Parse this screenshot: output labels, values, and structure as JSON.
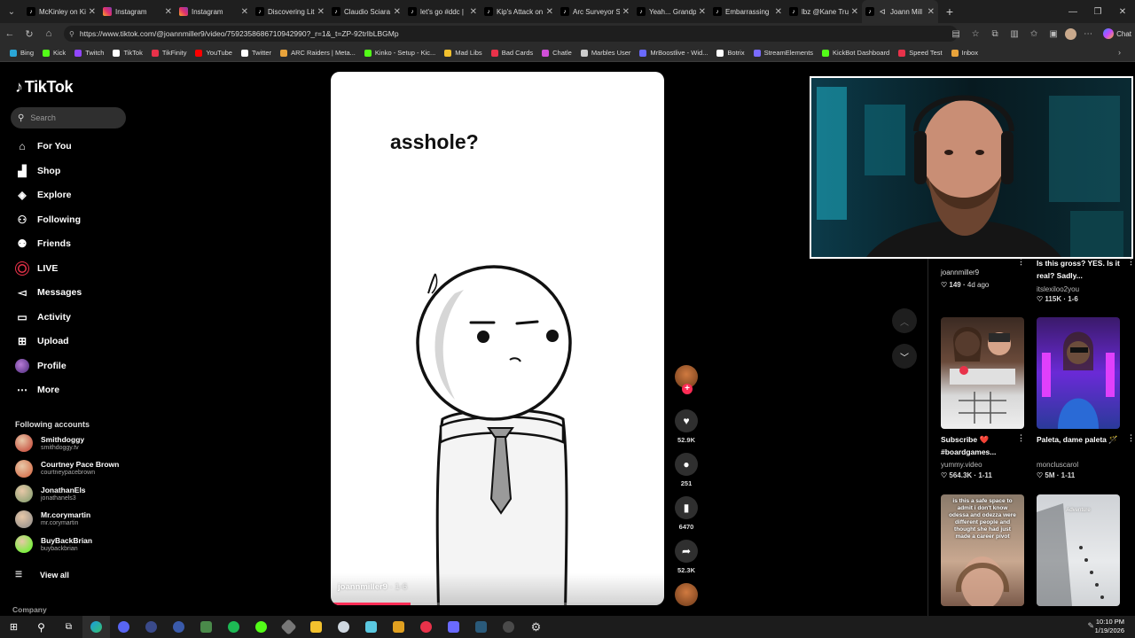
{
  "browser": {
    "tabs": [
      {
        "title": "McKinley on Ki",
        "favicon": "tiktok-icon"
      },
      {
        "title": "Instagram",
        "favicon": "instagram-icon"
      },
      {
        "title": "Instagram",
        "favicon": "instagram-icon"
      },
      {
        "title": "Discovering Lit",
        "favicon": "tiktok-icon"
      },
      {
        "title": "Claudio Sciara",
        "favicon": "tiktok-icon"
      },
      {
        "title": "let's go #ddc |",
        "favicon": "tiktok-icon"
      },
      {
        "title": "Kip's Attack on",
        "favicon": "tiktok-icon"
      },
      {
        "title": "Arc Surveyor Si",
        "favicon": "tiktok-icon"
      },
      {
        "title": "Yeah... Grandpa",
        "favicon": "tiktok-icon"
      },
      {
        "title": "Embarrassing",
        "favicon": "tiktok-icon"
      },
      {
        "title": "lbz @Kane Truj",
        "favicon": "tiktok-icon"
      },
      {
        "title": "Joann Mill",
        "favicon": "tiktok-icon"
      }
    ],
    "url": "https://www.tiktok.com/@joannmiller9/video/7592358686710942990?_r=1&_t=ZP-92trIbLBGMp",
    "copilot_label": "Chat",
    "bookmarks": [
      {
        "label": "Bing",
        "color": "#2aa6d6"
      },
      {
        "label": "Kick",
        "color": "#53fc18"
      },
      {
        "label": "Twitch",
        "color": "#9146ff"
      },
      {
        "label": "TikTok",
        "color": "#ffffff"
      },
      {
        "label": "TikFinity",
        "color": "#e8324a"
      },
      {
        "label": "YouTube",
        "color": "#ff0000"
      },
      {
        "label": "Twitter",
        "color": "#ffffff"
      },
      {
        "label": "ARC Raiders | Meta...",
        "color": "#e8a33b"
      },
      {
        "label": "Kinko - Setup - Kic...",
        "color": "#53fc18"
      },
      {
        "label": "Mad Libs",
        "color": "#f2c12e"
      },
      {
        "label": "Bad Cards",
        "color": "#e8324a"
      },
      {
        "label": "Chatle",
        "color": "#d04fd8"
      },
      {
        "label": "Marbles User",
        "color": "#cccccc"
      },
      {
        "label": "MrBoostlive - Wid...",
        "color": "#6a6aff"
      },
      {
        "label": "Botrix",
        "color": "#ffffff"
      },
      {
        "label": "StreamElements",
        "color": "#7a6bff"
      },
      {
        "label": "KickBot Dashboard",
        "color": "#53fc18"
      },
      {
        "label": "Speed Test",
        "color": "#e8324a"
      },
      {
        "label": "Inbox",
        "color": "#e8a33b"
      }
    ]
  },
  "tiktok": {
    "logo_text": "TikTok",
    "search_placeholder": "Search",
    "menu": [
      {
        "label": "For You",
        "icon": "home-icon"
      },
      {
        "label": "Shop",
        "icon": "shop-icon"
      },
      {
        "label": "Explore",
        "icon": "compass-icon"
      },
      {
        "label": "Following",
        "icon": "following-icon"
      },
      {
        "label": "Friends",
        "icon": "friends-icon"
      },
      {
        "label": "LIVE",
        "icon": "live-icon"
      },
      {
        "label": "Messages",
        "icon": "messages-icon"
      },
      {
        "label": "Activity",
        "icon": "activity-icon"
      },
      {
        "label": "Upload",
        "icon": "upload-icon"
      },
      {
        "label": "Profile",
        "icon": "profile-icon"
      },
      {
        "label": "More",
        "icon": "more-icon"
      }
    ],
    "following_title": "Following accounts",
    "following": [
      {
        "name": "Smithdoggy",
        "handle": "smithdoggy.tv",
        "color": "#c0392b"
      },
      {
        "name": "Courtney Pace Brown",
        "handle": "courtneypacebrown",
        "color": "#d35f3a"
      },
      {
        "name": "JonathanEls",
        "handle": "jonathanels3",
        "color": "#7a9a6a"
      },
      {
        "name": "Mr.corymartin",
        "handle": "mr.corymartin",
        "color": "#888888"
      },
      {
        "name": "BuyBackBrian",
        "handle": "buybackbrian",
        "color": "#53fc18"
      }
    ],
    "view_all": "View all",
    "company": "Company",
    "video": {
      "caption": "asshole?",
      "author": "joannmiller9",
      "date": "1-6",
      "progress": 0.24
    },
    "actions": {
      "likes": "52.9K",
      "comments": "251",
      "saves": "6470",
      "shares": "52.3K"
    },
    "right": {
      "top_left": {
        "author": "joannmiller9",
        "likes": "149",
        "age": "4d ago"
      },
      "top_right": {
        "title": "Is this gross? YES. Is it real? Sadly...",
        "author": "itslexiloo2you",
        "likes": "115K",
        "date": "1-6"
      },
      "card1": {
        "title": "Subscribe ❤️ #boardgames...",
        "author": "yummy.video",
        "likes": "564.3K",
        "date": "1-11"
      },
      "card2": {
        "title": "Paleta, dame paleta 🪄",
        "author": "moncluscarol",
        "likes": "5M",
        "date": "1-11"
      },
      "card3_overlay": "is this a safe space to admit i don't know odessa and odezza were different people and thought she had just made a career pivot",
      "card4_overlay": "Adventure"
    }
  },
  "taskbar": {
    "time": "10:10 PM",
    "date": "1/19/2026"
  }
}
